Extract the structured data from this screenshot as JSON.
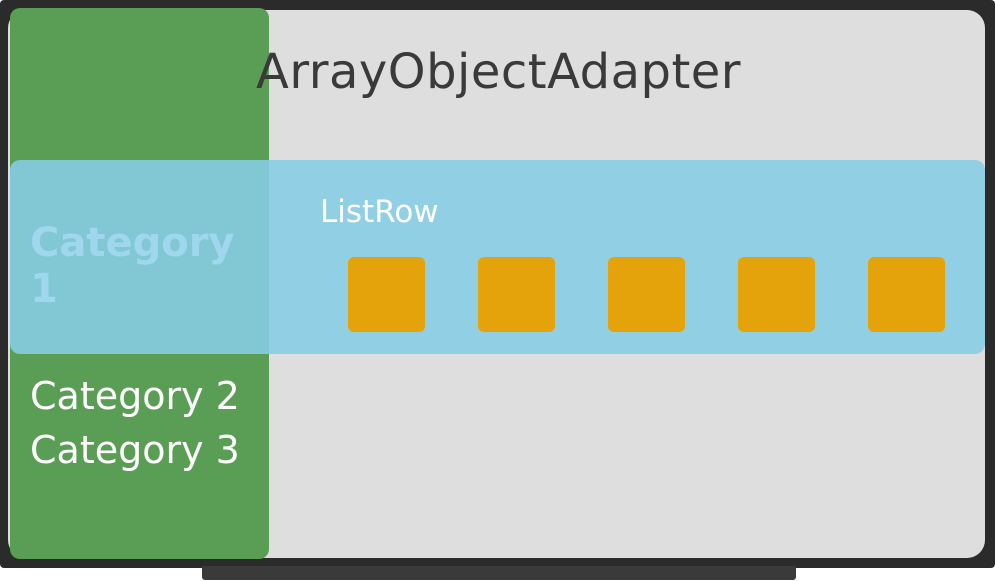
{
  "title": "ArrayObjectAdapter",
  "row": {
    "label": "ListRow",
    "card_count": 5
  },
  "categories": [
    {
      "label": "Category 1",
      "selected": true
    },
    {
      "label": "Category 2",
      "selected": false
    },
    {
      "label": "Category 3",
      "selected": false
    }
  ],
  "colors": {
    "nav_pane": "#5a9e55",
    "screen": "#dedede",
    "selected_row": "#86cde6",
    "card": "#e5a30b",
    "frame": "#2b2b2b"
  }
}
